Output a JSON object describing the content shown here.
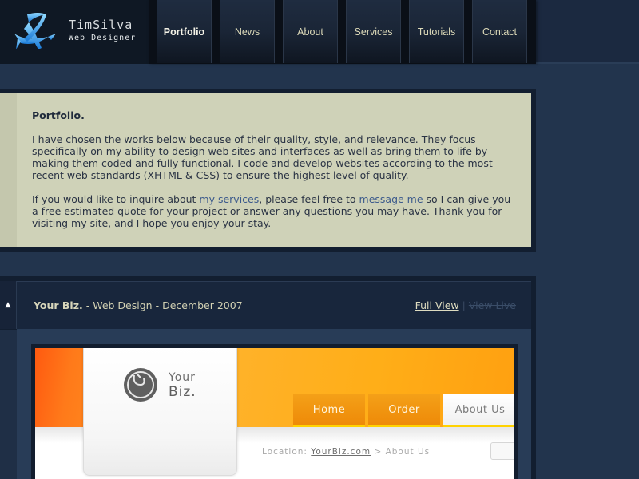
{
  "header": {
    "logo": {
      "icon": "stylized-blue-crossed-blades-logo",
      "name": "TimSilva",
      "tagline": "Web Designer"
    },
    "nav": [
      {
        "label": "Portfolio",
        "active": true
      },
      {
        "label": "News",
        "active": false
      },
      {
        "label": "About",
        "active": false
      },
      {
        "label": "Services",
        "active": false
      },
      {
        "label": "Tutorials",
        "active": false
      },
      {
        "label": "Contact",
        "active": false
      }
    ]
  },
  "intro": {
    "heading": "Portfolio.",
    "paragraph1": "I have chosen the works below because of their quality, style, and relevance. They focus specifically on my ability to design web sites and interfaces as well as bring them to life by making them coded and fully functional. I code and develop websites according to the most recent web standards (XHTML & CSS) to ensure the highest level of quality.",
    "paragraph2": {
      "before_link1": "If you would like to inquire about ",
      "link1": "my services",
      "between_links": ", please feel free to ",
      "link2": "message me",
      "after_link2": " so I can give you a free estimated quote for your project or answer any questions you may have. Thank you for visiting my site, and I hope you enjoy your stay."
    }
  },
  "portfolio_item": {
    "toggle_icon": "triangle-up-icon",
    "title": "Your Biz.",
    "category": " - Web Design - ",
    "date": "December 2007",
    "full_view_label": "Full View",
    "separator": "|",
    "view_live_label": "View Live",
    "preview": {
      "logo_line1": "Your",
      "logo_line2": "Biz.",
      "nav": [
        "Home",
        "Order",
        "About Us"
      ],
      "location_prefix": "Location: ",
      "location_link": "YourBiz.com",
      "location_suffix": " > About Us"
    }
  },
  "colors": {
    "page_bg": "#22344d",
    "intro_bg": "#cfd2b8",
    "link": "#3c5a8c",
    "preview_orange": "#ffae18",
    "nav_text": "#dcd9b8"
  }
}
